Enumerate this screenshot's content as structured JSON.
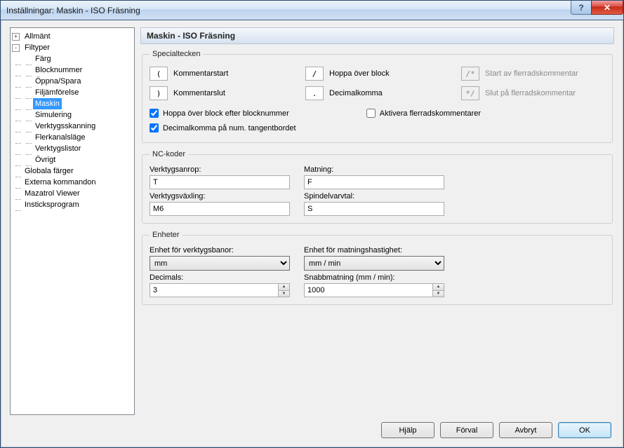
{
  "window": {
    "title": "Inställningar: Maskin - ISO Fräsning"
  },
  "tree": {
    "root": [
      {
        "label": "Allmänt",
        "toggle": "+"
      },
      {
        "label": "Filtyper",
        "toggle": "-",
        "children": [
          "Färg",
          "Blocknummer",
          "Öppna/Spara",
          "Filjämförelse",
          "Maskin",
          "Simulering",
          "Verktygsskanning",
          "Flerkanalsläge",
          "Verktygslistor",
          "Övrigt"
        ],
        "selected": "Maskin"
      },
      {
        "label": "Globala färger"
      },
      {
        "label": "Externa kommandon"
      },
      {
        "label": "Mazatrol Viewer"
      },
      {
        "label": "Insticksprogram"
      }
    ]
  },
  "content": {
    "header": "Maskin - ISO Fräsning",
    "special": {
      "legend": "Specialtecken",
      "items": {
        "comment_start": {
          "char": "(",
          "label": "Kommentarstart"
        },
        "skip_block": {
          "char": "/",
          "label": "Hoppa över block"
        },
        "ml_start": {
          "char": "/*",
          "label": "Start av flerradskommentar"
        },
        "comment_end": {
          "char": ")",
          "label": "Kommentarslut"
        },
        "decimal": {
          "char": ".",
          "label": "Decimalkomma"
        },
        "ml_end": {
          "char": "*/",
          "label": "Slut på flerradskommentar"
        }
      },
      "cb_skip_after_blocknum": {
        "checked": true,
        "label": "Hoppa över block efter blocknummer"
      },
      "cb_enable_ml": {
        "checked": false,
        "label": "Aktivera flerradskommentarer"
      },
      "cb_decimal_numpad": {
        "checked": true,
        "label": "Decimalkomma på num. tangentbordet"
      }
    },
    "nc": {
      "legend": "NC-koder",
      "tool_call": {
        "label": "Verktygsanrop:",
        "value": "T"
      },
      "feed": {
        "label": "Matning:",
        "value": "F"
      },
      "tool_change": {
        "label": "Verktygsväxling:",
        "value": "M6"
      },
      "spindle": {
        "label": "Spindelvarvtal:",
        "value": "S"
      }
    },
    "units": {
      "legend": "Enheter",
      "toolpath_unit": {
        "label": "Enhet för verktygsbanor:",
        "value": "mm"
      },
      "feed_unit": {
        "label": "Enhet för matningshastighet:",
        "value": "mm / min"
      },
      "decimals": {
        "label": "Decimals:",
        "value": "3"
      },
      "rapid": {
        "label": "Snabbmatning (mm / min):",
        "value": "1000"
      }
    }
  },
  "buttons": {
    "help": "Hjälp",
    "defaults": "Förval",
    "cancel": "Avbryt",
    "ok": "OK"
  }
}
